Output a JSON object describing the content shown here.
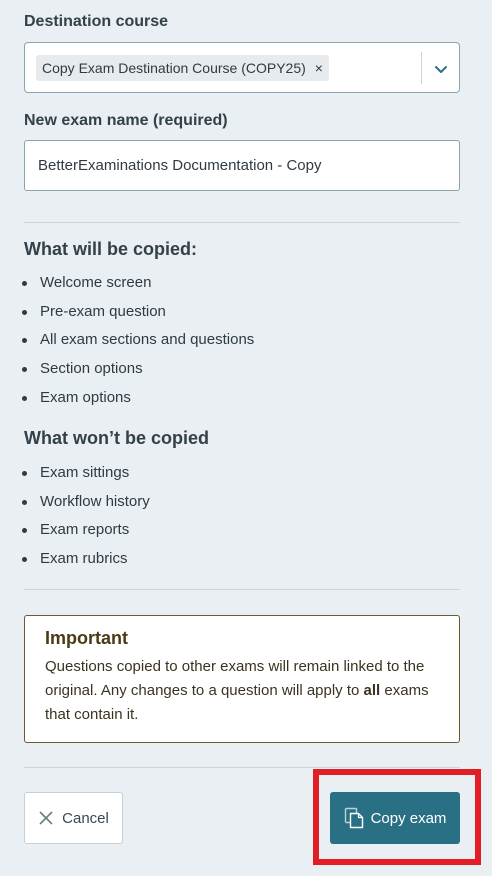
{
  "destination": {
    "label": "Destination course",
    "selected_chip": "Copy Exam Destination Course (COPY25)",
    "chip_remove": "×"
  },
  "exam_name": {
    "label": "New exam name (required)",
    "value": "BetterExaminations Documentation - Copy"
  },
  "will_copy": {
    "heading": "What will be copied:",
    "items": [
      "Welcome screen",
      "Pre-exam question",
      "All exam sections and questions",
      "Section options",
      "Exam options"
    ]
  },
  "wont_copy": {
    "heading": "What won’t be copied",
    "items": [
      "Exam sittings",
      "Workflow history",
      "Exam reports",
      "Exam rubrics"
    ]
  },
  "important": {
    "title": "Important",
    "text_before": "Questions copied to other exams will remain linked to the original. Any changes to a question will apply to ",
    "text_bold": "all",
    "text_after": " exams that contain it."
  },
  "actions": {
    "cancel_label": "Cancel",
    "copy_label": "Copy exam"
  },
  "colors": {
    "primary": "#2a7085",
    "highlight": "#e11d25",
    "background": "#e9eff2"
  }
}
